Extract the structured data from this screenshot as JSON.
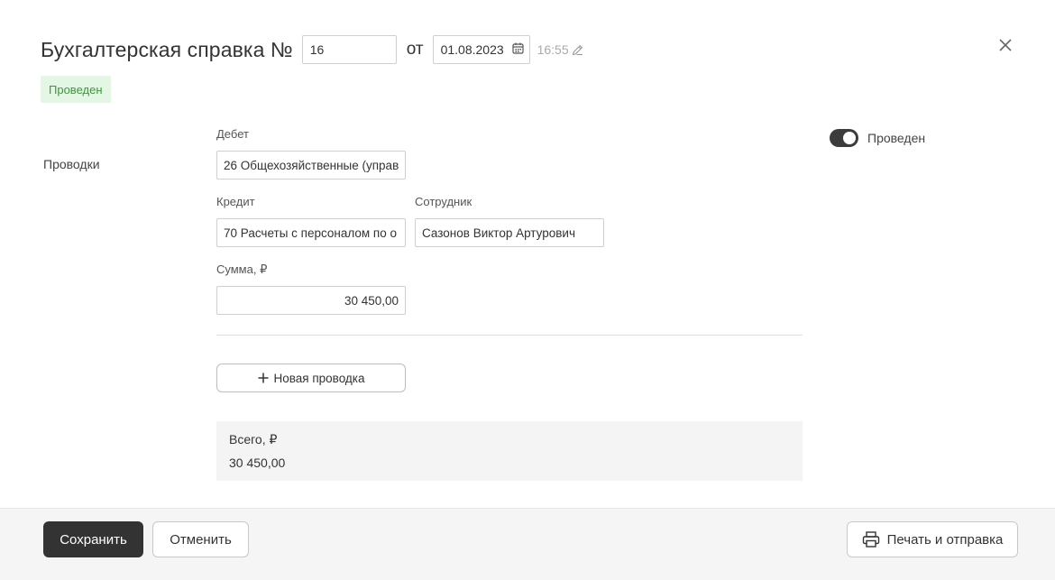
{
  "header": {
    "title": "Бухгалтерская справка №",
    "number": "16",
    "ot_label": "от",
    "date": "01.08.2023",
    "time": "16:55"
  },
  "status_badge": "Проведен",
  "section_label": "Проводки",
  "entry": {
    "debit_label": "Дебет",
    "debit_value": "26 Общехозяйственные (управ",
    "credit_label": "Кредит",
    "credit_value": "70 Расчеты с персоналом по о",
    "employee_label": "Сотрудник",
    "employee_value": "Сазонов Виктор Артурович",
    "sum_label": "Сумма, ₽",
    "sum_value": "30 450,00"
  },
  "new_entry_label": "Новая проводка",
  "total": {
    "label": "Всего, ₽",
    "value": "30 450,00"
  },
  "posted_toggle": {
    "label": "Проведен",
    "on": true
  },
  "footer": {
    "save_label": "Сохранить",
    "cancel_label": "Отменить",
    "print_label": "Печать и отправка"
  }
}
